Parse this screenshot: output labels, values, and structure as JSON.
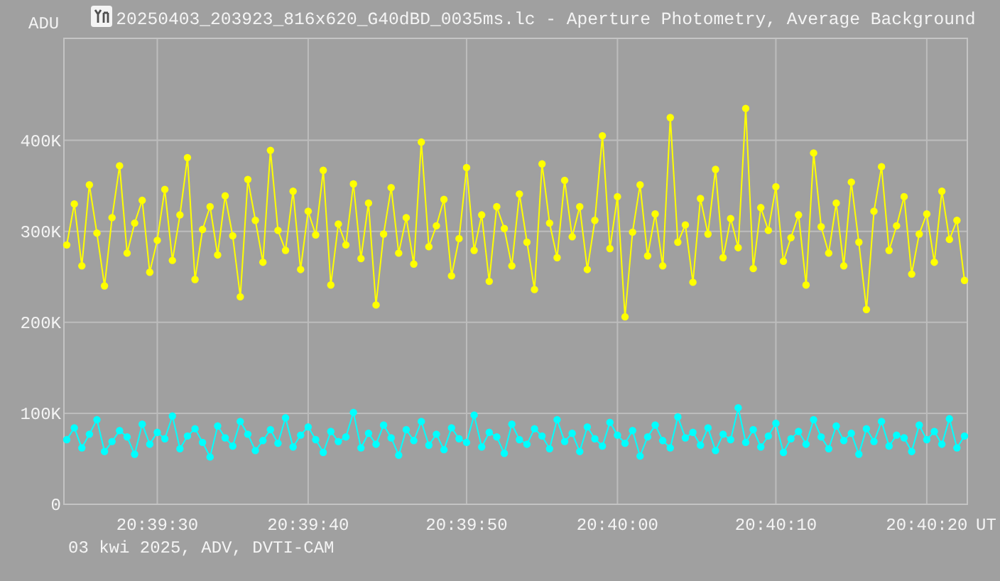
{
  "window": {
    "title": "20250403_203923_816x620_G40dBD_0035ms.lc - Aperture Photometry, Average Background"
  },
  "plot": {
    "chart_data": {
      "type": "line",
      "xlabel": "UT",
      "ylabel": "ADU",
      "grid": true,
      "ylim": [
        0,
        512
      ],
      "yticks": [
        {
          "value": 400,
          "label": "400K"
        },
        {
          "value": 300,
          "label": "300K"
        },
        {
          "value": 200,
          "label": "200K"
        },
        {
          "value": 100,
          "label": "100K"
        },
        {
          "value": 0,
          "label": "0"
        }
      ],
      "categories": [
        null,
        null,
        null,
        null,
        null,
        null,
        null,
        null,
        null,
        null,
        null,
        null,
        "20:39:30",
        null,
        null,
        null,
        null,
        null,
        null,
        null,
        null,
        null,
        null,
        null,
        null,
        null,
        null,
        null,
        null,
        null,
        null,
        null,
        "20:39:40",
        null,
        null,
        null,
        null,
        null,
        null,
        null,
        null,
        null,
        null,
        null,
        null,
        null,
        null,
        null,
        null,
        null,
        null,
        null,
        null,
        "20:39:50",
        null,
        null,
        null,
        null,
        null,
        null,
        null,
        null,
        null,
        null,
        null,
        null,
        null,
        null,
        null,
        null,
        null,
        null,
        null,
        "20:40:00",
        null,
        null,
        null,
        null,
        null,
        null,
        null,
        null,
        null,
        null,
        null,
        null,
        null,
        null,
        null,
        null,
        null,
        null,
        null,
        null,
        "20:40:10",
        null,
        null,
        null,
        null,
        null,
        null,
        null,
        null,
        null,
        null,
        null,
        null,
        null,
        null,
        null,
        null,
        null,
        null,
        null,
        "20:40:20",
        null,
        null,
        null,
        null,
        null
      ],
      "series": [
        {
          "color": "#ffff00",
          "marker": "circle",
          "values": [
            285,
            330,
            262,
            351,
            298,
            240,
            315,
            372,
            276,
            309,
            334,
            255,
            290,
            346,
            268,
            318,
            381,
            247,
            302,
            327,
            274,
            339,
            295,
            228,
            357,
            312,
            266,
            389,
            301,
            279,
            344,
            258,
            322,
            296,
            367,
            241,
            308,
            285,
            352,
            270,
            331,
            219,
            297,
            348,
            276,
            315,
            264,
            398,
            283,
            306,
            335,
            251,
            292,
            370,
            279,
            318,
            245,
            327,
            303,
            262,
            341,
            288,
            236,
            374,
            309,
            271,
            356,
            294,
            327,
            258,
            312,
            405,
            281,
            338,
            206,
            299,
            351,
            273,
            319,
            262,
            425,
            288,
            307,
            244,
            336,
            297,
            368,
            271,
            314,
            282,
            435,
            259,
            326,
            301,
            349,
            267,
            293,
            318,
            241,
            386,
            305,
            276,
            331,
            262,
            354,
            288,
            214,
            322,
            371,
            279,
            306,
            338,
            253,
            297,
            319,
            266,
            344,
            291,
            312,
            246
          ]
        },
        {
          "color": "#00ffff",
          "marker": "circle",
          "values": [
            71,
            84,
            62,
            77,
            93,
            58,
            69,
            81,
            74,
            55,
            88,
            66,
            79,
            72,
            97,
            61,
            75,
            83,
            68,
            52,
            86,
            73,
            64,
            91,
            77,
            59,
            70,
            82,
            67,
            95,
            63,
            76,
            85,
            71,
            57,
            80,
            69,
            74,
            101,
            62,
            78,
            66,
            87,
            73,
            54,
            82,
            70,
            91,
            65,
            77,
            60,
            84,
            72,
            68,
            98,
            63,
            79,
            74,
            56,
            88,
            71,
            66,
            83,
            75,
            61,
            93,
            69,
            78,
            58,
            85,
            72,
            64,
            90,
            76,
            67,
            81,
            53,
            74,
            87,
            70,
            62,
            96,
            73,
            79,
            65,
            84,
            59,
            77,
            71,
            106,
            68,
            82,
            63,
            75,
            89,
            57,
            72,
            80,
            66,
            93,
            74,
            61,
            86,
            70,
            78,
            55,
            83,
            69,
            91,
            64,
            76,
            73,
            58,
            87,
            71,
            80,
            66,
            94,
            62,
            75
          ]
        }
      ]
    }
  },
  "footer": "03 kwi 2025, ADV, DVTI-CAM"
}
